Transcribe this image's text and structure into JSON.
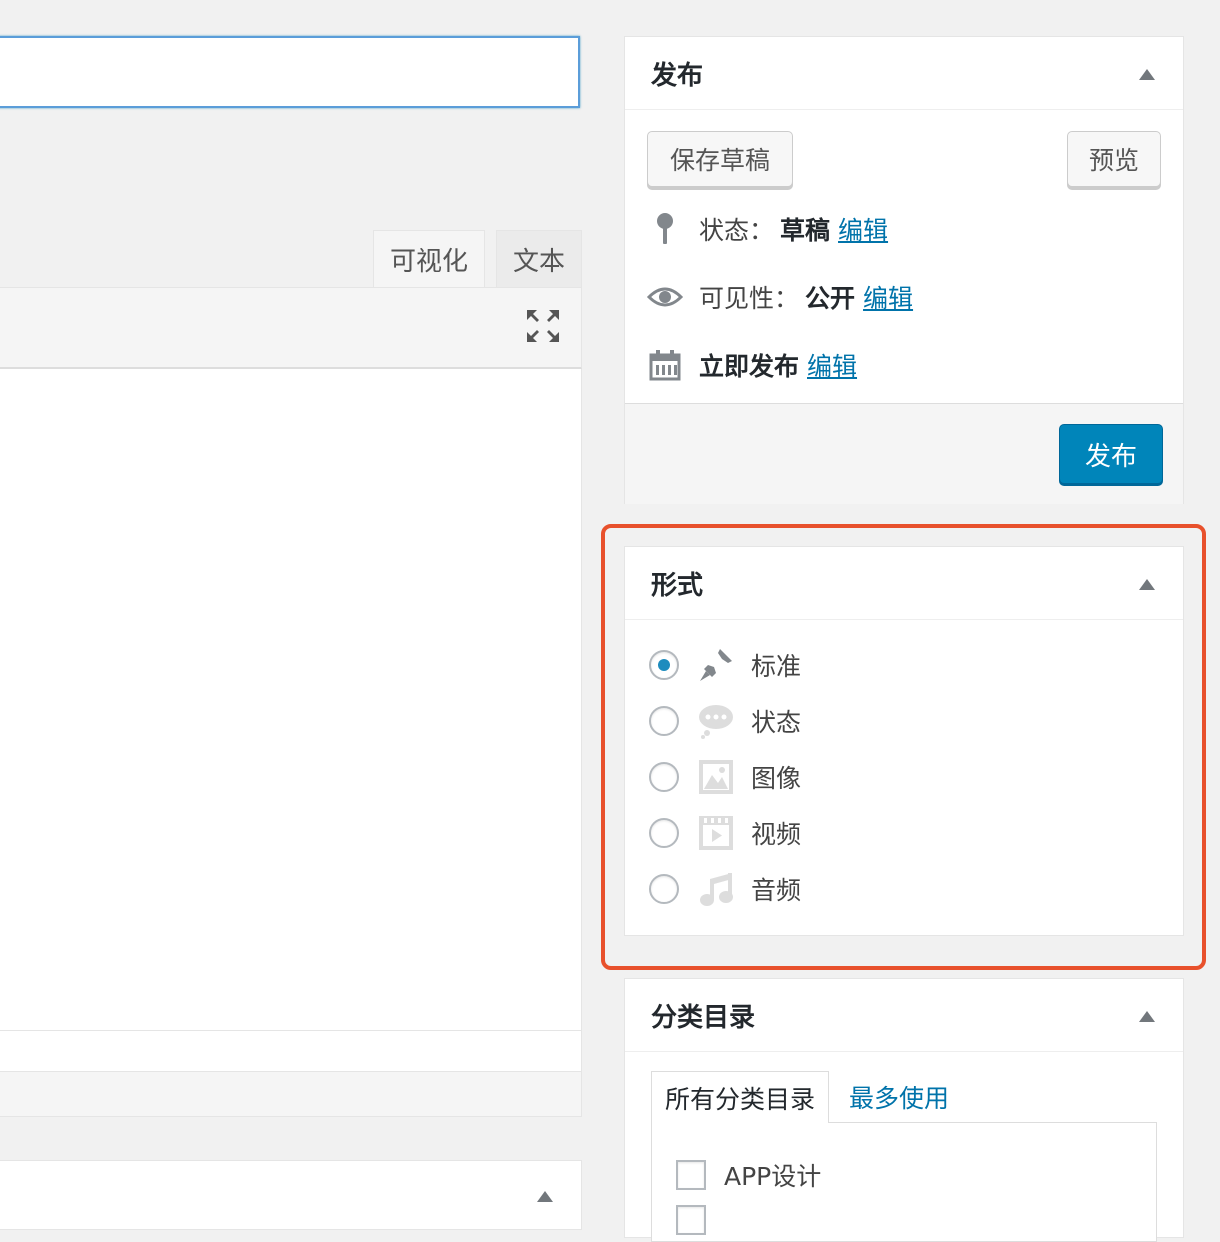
{
  "editor": {
    "tabs": {
      "visual": "可视化",
      "text": "文本"
    }
  },
  "publish_box": {
    "title": "发布",
    "save_draft": "保存草稿",
    "preview": "预览",
    "status_label": "状态：",
    "status_value": "草稿",
    "visibility_label": "可见性：",
    "visibility_value": "公开",
    "schedule_label": "立即发布",
    "edit_link": "编辑",
    "publish_button": "发布"
  },
  "format_box": {
    "title": "形式",
    "options": [
      {
        "label": "标准",
        "checked": true,
        "icon": "pushpin-icon"
      },
      {
        "label": "状态",
        "checked": false,
        "icon": "chat-bubble-icon"
      },
      {
        "label": "图像",
        "checked": false,
        "icon": "image-icon"
      },
      {
        "label": "视频",
        "checked": false,
        "icon": "video-icon"
      },
      {
        "label": "音频",
        "checked": false,
        "icon": "music-note-icon"
      }
    ]
  },
  "category_box": {
    "title": "分类目录",
    "tab_all": "所有分类目录",
    "tab_popular": "最多使用",
    "items": [
      "APP设计"
    ]
  },
  "colors": {
    "accent": "#0085ba",
    "link": "#0073aa",
    "highlight": "#e8512c"
  }
}
